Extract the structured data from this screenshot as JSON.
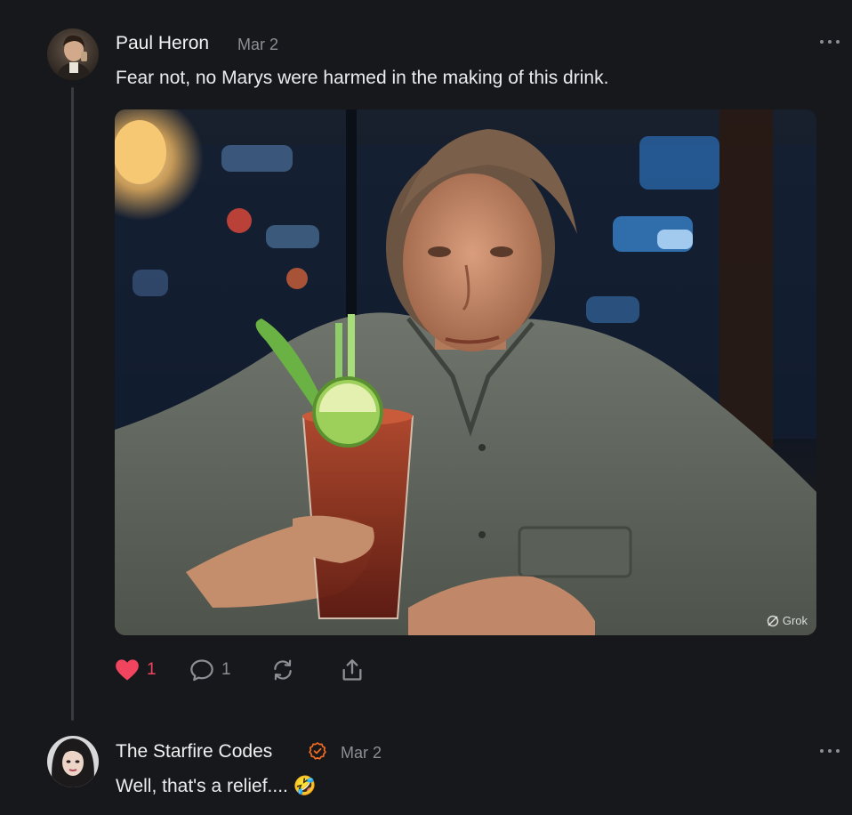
{
  "post": {
    "author": "Paul Heron",
    "date": "Mar 2",
    "text": "Fear not, no Marys were harmed in the making of this drink.",
    "image_watermark": "Grok",
    "likes": "1",
    "comments": "1",
    "liked": true,
    "icons": [
      "heart-icon",
      "comment-icon",
      "restack-icon",
      "share-icon",
      "more-icon"
    ]
  },
  "reply": {
    "author": "The Starfire Codes",
    "date": "Mar 2",
    "text": "Well, that's a relief.... 🤣",
    "verified": true
  },
  "colors": {
    "background": "#17181b",
    "like_accent": "#f0445f",
    "verified_accent": "#f26b21",
    "muted_text": "#8d8e94"
  }
}
